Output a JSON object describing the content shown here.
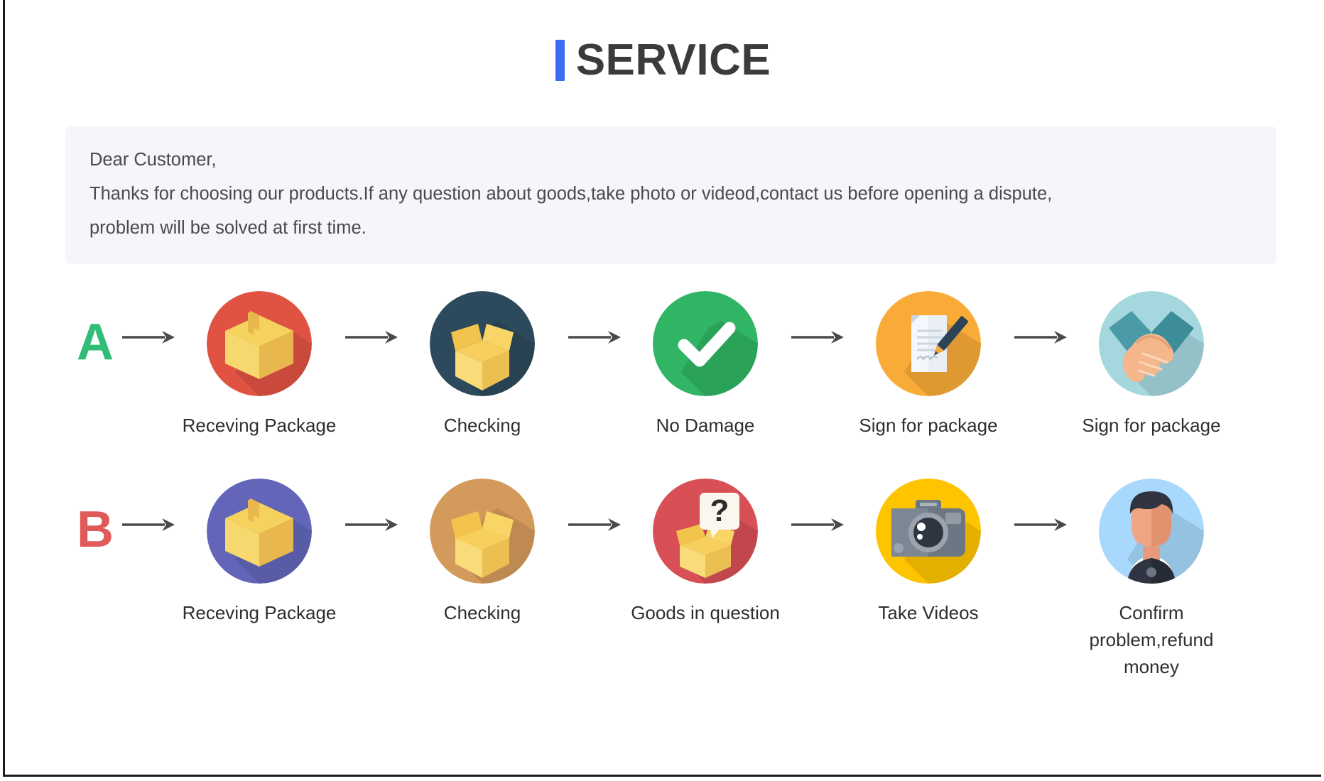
{
  "page": {
    "title": "SERVICE",
    "accent_color": "#3b6df2",
    "title_color": "#3b3b3b",
    "background": "#ffffff"
  },
  "notice": {
    "background": "#f4f6fa",
    "lines": [
      "Dear Customer,",
      "Thanks for choosing our products.If any question about goods,take photo or videod,contact us before opening a dispute,",
      "problem will be solved at first time."
    ]
  },
  "flows": [
    {
      "letter": "A",
      "letter_color": "#2fbd77",
      "steps": [
        {
          "label": "Receving Package",
          "icon": "closed-box-icon",
          "circle_color": "#e05343"
        },
        {
          "label": "Checking",
          "icon": "open-box-icon",
          "circle_color": "#2d4a5c"
        },
        {
          "label": "No Damage",
          "icon": "check-mark-icon",
          "circle_color": "#2fb563"
        },
        {
          "label": "Sign for package",
          "icon": "document-pen-icon",
          "circle_color": "#f9ab38"
        },
        {
          "label": "Sign for package",
          "icon": "handshake-icon",
          "circle_color": "#a5d7de"
        }
      ]
    },
    {
      "letter": "B",
      "letter_color": "#e05a5a",
      "steps": [
        {
          "label": "Receving Package",
          "icon": "closed-box-icon",
          "circle_color": "#6366b8"
        },
        {
          "label": "Checking",
          "icon": "open-box-icon",
          "circle_color": "#d49a5c"
        },
        {
          "label": "Goods in question",
          "icon": "question-box-icon",
          "circle_color": "#d85055"
        },
        {
          "label": "Take Videos",
          "icon": "camera-icon",
          "circle_color": "#fec400"
        },
        {
          "label": "Confirm problem,refund money",
          "icon": "support-agent-icon",
          "circle_color": "#a8d8fb"
        }
      ]
    }
  ],
  "arrow": {
    "name": "right-arrow-icon",
    "color": "#4a4a4a"
  }
}
